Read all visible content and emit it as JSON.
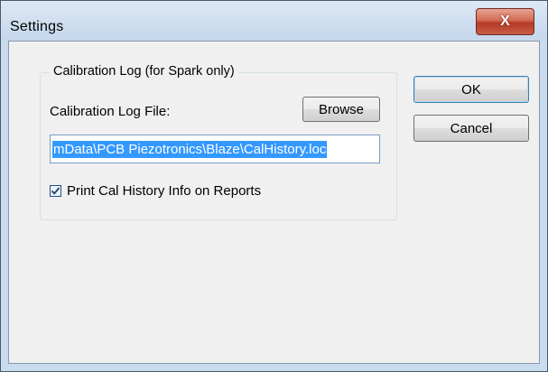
{
  "window": {
    "title": "Settings",
    "close_label": "X"
  },
  "group": {
    "label": "Calibration Log (for Spark only)",
    "file_label": "Calibration Log File:",
    "browse_label": "Browse",
    "path_value": "mData\\PCB Piezotronics\\Blaze\\CalHistory.loc",
    "checkbox_label": "Print Cal History Info on Reports",
    "checkbox_checked": true
  },
  "buttons": {
    "ok_label": "OK",
    "cancel_label": "Cancel"
  }
}
